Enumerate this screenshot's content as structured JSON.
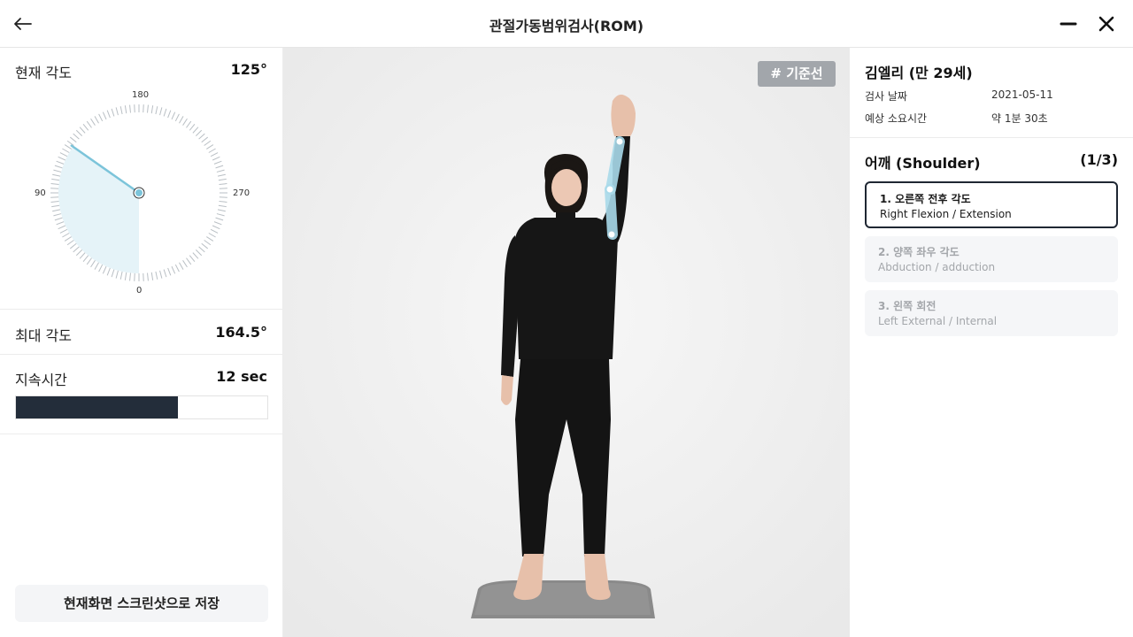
{
  "header": {
    "title": "관절가동범위검사(ROM)",
    "back_icon": "arrow-left-icon",
    "minimize_icon": "minus-icon",
    "close_icon": "close-icon"
  },
  "left_panel": {
    "current_angle_label": "현재 각도",
    "current_angle_value": "125°",
    "dial": {
      "label_top": "180",
      "label_left": "90",
      "label_right": "270",
      "label_bottom": "0",
      "angle_deg": 125,
      "fill_color": "#e5f3f8",
      "needle_color": "#7cc4da"
    },
    "max_angle_label": "최대 각도",
    "max_angle_value": "164.5°",
    "duration_label": "지속시간",
    "duration_value": "12 sec",
    "duration_progress": 0.645,
    "save_button_label": "현재화면 스크린샷으로 저장"
  },
  "center": {
    "baseline_button_label": "기준선",
    "baseline_icon": "grid-hash-icon",
    "arm_overlay_color": "#a9daea"
  },
  "right_panel": {
    "patient_name": "김엘리 (만 29세)",
    "info": [
      {
        "label": "검사 날짜",
        "value": "2021-05-11"
      },
      {
        "label": "예상 소요시간",
        "value": "약 1분 30초"
      }
    ],
    "section_title": "어깨 (Shoulder)",
    "section_count": "(1/3)",
    "tests": [
      {
        "title": "1. 오른쪽 전후 각도",
        "subtitle": "Right Flexion / Extension",
        "active": true
      },
      {
        "title": "2. 양쪽 좌우 각도",
        "subtitle": "Abduction / adduction",
        "active": false
      },
      {
        "title": "3. 왼쪽 회전",
        "subtitle": "Left External / Internal",
        "active": false
      }
    ]
  }
}
